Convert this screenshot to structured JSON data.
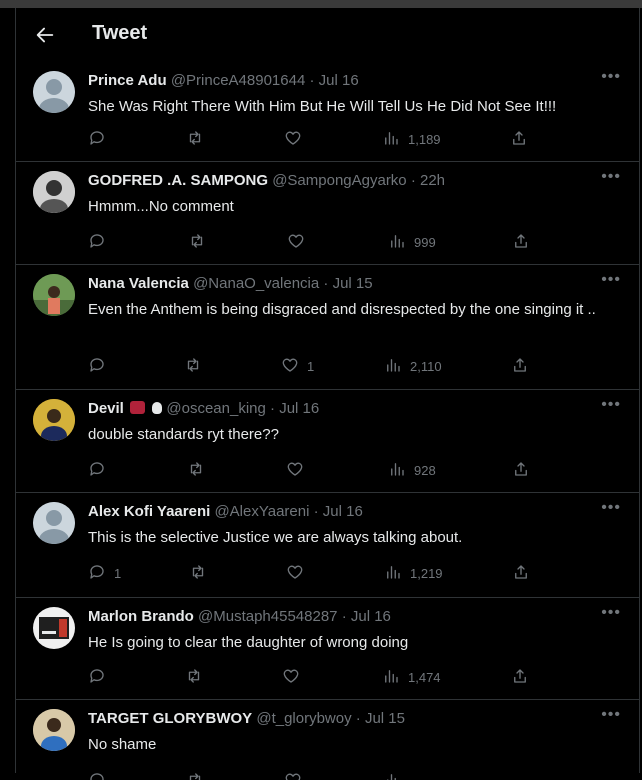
{
  "header": {
    "title": "Tweet"
  },
  "replies": [
    {
      "name": "Prince Adu",
      "handle": "@PrinceA48901644",
      "date": "Jul 16",
      "text": "She Was Right There With Him But He Will Tell Us He Did Not See It!!!",
      "replies": "",
      "likes": "",
      "views": "1,189"
    },
    {
      "name": "GODFRED .A. SAMPONG",
      "handle": "@SampongAgyarko",
      "date": "22h",
      "text": "Hmmm...No comment",
      "replies": "",
      "likes": "",
      "views": "999"
    },
    {
      "name": "Nana Valencia",
      "handle": "@NanaO_valencia",
      "date": "Jul 15",
      "text": "Even the Anthem is being disgraced and disrespected by the one singing it ..",
      "replies": "",
      "likes": "1",
      "views": "2,110"
    },
    {
      "name": "Devil",
      "handle": "@oscean_king",
      "date": "Jul 16",
      "text": "double standards ryt there??",
      "replies": "",
      "likes": "",
      "views": "928"
    },
    {
      "name": "Alex Kofi Yaareni",
      "handle": "@AlexYaareni",
      "date": "Jul 16",
      "text": "This is the selective Justice we are always talking about.",
      "replies": "1",
      "likes": "",
      "views": "1,219"
    },
    {
      "name": "Marlon Brando",
      "handle": "@Mustaph45548287",
      "date": "Jul 16",
      "text": "He Is going to clear the daughter of wrong doing",
      "replies": "",
      "likes": "",
      "views": "1,474"
    },
    {
      "name": "TARGET GLORYBWOY",
      "handle": "@t_glorybwoy",
      "date": "Jul 15",
      "text": "No shame",
      "replies": "",
      "likes": "",
      "views": ""
    }
  ],
  "colors": {
    "background": "#000000",
    "text": "#e7e9ea",
    "secondary": "#71767b",
    "divider": "#2f3336"
  },
  "icons": [
    "back-arrow-icon",
    "more-icon",
    "reply-icon",
    "retweet-icon",
    "like-icon",
    "views-icon",
    "share-icon"
  ]
}
